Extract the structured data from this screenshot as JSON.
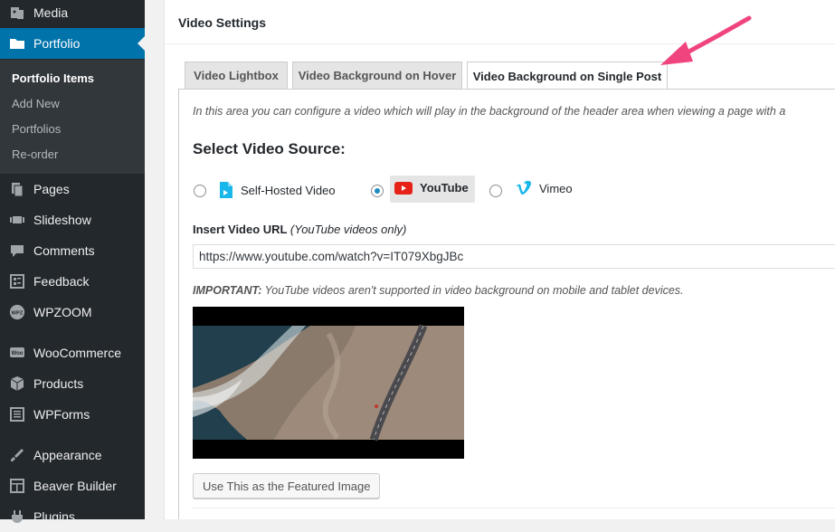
{
  "sidebar": {
    "menu": [
      {
        "label": "Media",
        "icon": "media-icon"
      },
      {
        "label": "Portfolio",
        "icon": "folder-icon",
        "active": true
      },
      {
        "label": "Pages",
        "icon": "pages-icon"
      },
      {
        "label": "Slideshow",
        "icon": "slideshow-icon"
      },
      {
        "label": "Comments",
        "icon": "comments-icon"
      },
      {
        "label": "Feedback",
        "icon": "feedback-icon"
      },
      {
        "label": "WPZOOM",
        "icon": "wpzoom-icon"
      },
      {
        "label": "WooCommerce",
        "icon": "woocommerce-icon"
      },
      {
        "label": "Products",
        "icon": "products-icon"
      },
      {
        "label": "WPForms",
        "icon": "wpforms-icon"
      },
      {
        "label": "Appearance",
        "icon": "appearance-icon"
      },
      {
        "label": "Beaver Builder",
        "icon": "beaver-builder-icon"
      },
      {
        "label": "Plugins",
        "icon": "plugins-icon"
      }
    ],
    "submenu": [
      "Portfolio Items",
      "Add New",
      "Portfolios",
      "Re-order"
    ],
    "wpzoom_badge": "WPZ",
    "woo_badge": "Woo"
  },
  "panel": {
    "title": "Video Settings",
    "tabs": [
      "Video Lightbox",
      "Video Background on Hover",
      "Video Background on Single Post"
    ],
    "active_tab": 2,
    "intro": "In this area you can configure a video which will play in the background of the header area when viewing a page with a",
    "section_title": "Select Video Source:",
    "sources": [
      {
        "label": "Self-Hosted Video",
        "checked": false
      },
      {
        "label": "YouTube",
        "checked": true
      },
      {
        "label": "Vimeo",
        "checked": false
      }
    ],
    "url_label": "Insert Video URL",
    "url_label_note": "(YouTube videos only)",
    "url_value": "https://www.youtube.com/watch?v=IT079XbgJBc",
    "important_label": "IMPORTANT:",
    "important_text": " YouTube videos aren't supported in video background on mobile and tablet devices.",
    "featured_button": "Use This as the Featured Image"
  },
  "colors": {
    "sidebar_bg": "#23282d",
    "active_bg": "#0073aa",
    "arrow": "#f0447f",
    "youtube_red": "#e62117",
    "vimeo_blue": "#1ab7ea"
  }
}
